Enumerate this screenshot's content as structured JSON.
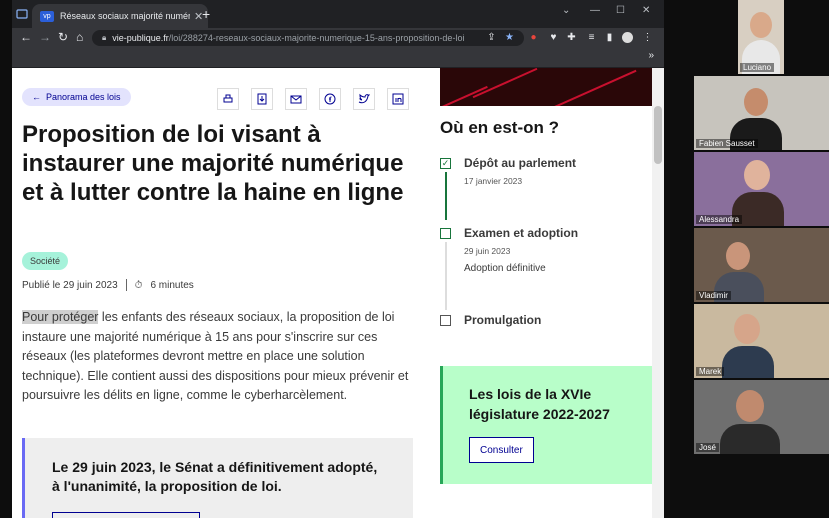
{
  "browser": {
    "tab_title": "Réseaux sociaux majorité numérique",
    "tab_close": "✕",
    "new_tab": "+",
    "url_domain": "vie-publique.fr",
    "url_path": "/loi/288274-reseaux-sociaux-majorite-numerique-15-ans-proposition-de-loi",
    "bookmarks_more": "»"
  },
  "page": {
    "breadcrumb": "Panorama des lois",
    "title": "Proposition de loi visant à instaurer une majorité numérique et à lutter contre la haine en ligne",
    "tag": "Société",
    "published": "Publié le 29 juin 2023",
    "reading_time": "6 minutes",
    "lead_highlight": "Pour protéger",
    "lead_rest": " les enfants des réseaux sociaux, la proposition de loi instaure une majorité numérique à 15 ans pour s'inscrire sur ces réseaux (les plateformes devront mettre en place une solution technique). Elle contient aussi des dispositions pour mieux prévenir et poursuivre les délits en ligne, comme le cyberharcèlement.",
    "callout": "Le 29 juin 2023, le Sénat a définitivement adopté, à l'unanimité, la proposition de loi."
  },
  "sidebar": {
    "status_title": "Où en est-on ?",
    "steps": [
      {
        "label": "Dépôt au parlement",
        "date": "17 janvier 2023",
        "sub": ""
      },
      {
        "label": "Examen et adoption",
        "date": "29 juin 2023",
        "sub": "Adoption définitive"
      },
      {
        "label": "Promulgation",
        "date": "",
        "sub": ""
      }
    ],
    "lois_title": "Les lois de la XVIe législature 2022-2027",
    "lois_button": "Consulter"
  },
  "participants": [
    "Luciano",
    "Fabien Sausset",
    "Alessandra",
    "Vladimir",
    "Marek",
    "José"
  ],
  "colors": {
    "accent": "#000091",
    "green": "#18753c",
    "mint": "#b8fec9"
  }
}
